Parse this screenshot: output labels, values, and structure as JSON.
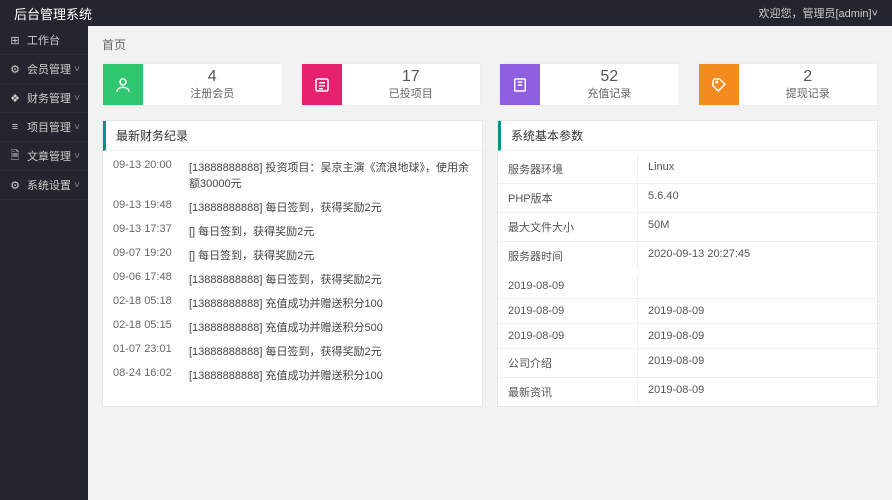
{
  "header": {
    "title": "后台管理系统",
    "user_text": "欢迎您，管理员[admin]",
    "chevron": "˅"
  },
  "sidebar": {
    "items": [
      {
        "icon": "⊞",
        "label": "工作台",
        "expandable": false
      },
      {
        "icon": "⚙",
        "label": "会员管理",
        "expandable": true
      },
      {
        "icon": "❖",
        "label": "财务管理",
        "expandable": true
      },
      {
        "icon": "≡",
        "label": "项目管理",
        "expandable": true
      },
      {
        "icon": "🗎",
        "label": "文章管理",
        "expandable": true
      },
      {
        "icon": "⚙",
        "label": "系统设置",
        "expandable": true
      }
    ]
  },
  "breadcrumb": "首页",
  "stats": [
    {
      "color": "#2ec770",
      "icon": "user",
      "num": "4",
      "label": "注册会员"
    },
    {
      "color": "#e6216f",
      "icon": "list",
      "num": "17",
      "label": "已投项目"
    },
    {
      "color": "#8e5fe0",
      "icon": "note",
      "num": "52",
      "label": "充值记录"
    },
    {
      "color": "#f58b1e",
      "icon": "tag",
      "num": "2",
      "label": "提现记录"
    }
  ],
  "finance": {
    "title": "最新财务纪录",
    "rows": [
      {
        "time": "09-13 20:00",
        "text": "[13888888888] 投资项目：吴京主演《流浪地球》，使用余额30000元"
      },
      {
        "time": "09-13 19:48",
        "text": "[13888888888] 每日签到，获得奖励2元"
      },
      {
        "time": "09-13 17:37",
        "text": "[] 每日签到，获得奖励2元"
      },
      {
        "time": "09-07 19:20",
        "text": "[] 每日签到，获得奖励2元"
      },
      {
        "time": "09-06 17:48",
        "text": "[13888888888] 每日签到，获得奖励2元"
      },
      {
        "time": "02-18 05:18",
        "text": "[13888888888] 充值成功并赠送积分100"
      },
      {
        "time": "02-18 05:15",
        "text": "[13888888888] 充值成功并赠送积分500"
      },
      {
        "time": "01-07 23:01",
        "text": "[13888888888] 每日签到，获得奖励2元"
      },
      {
        "time": "08-24 16:02",
        "text": "[13888888888] 充值成功并赠送积分100"
      }
    ]
  },
  "system": {
    "title": "系统基本参数",
    "rows": [
      {
        "k": "服务器环境",
        "v": "Linux"
      },
      {
        "k": "PHP版本",
        "v": "5.6.40"
      },
      {
        "k": "最大文件大小",
        "v": "50M"
      },
      {
        "k": "服务器时间",
        "v": "2020-09-13 20:27:45"
      }
    ]
  },
  "extra_rows": [
    {
      "a": "2019-08-09",
      "b": ""
    },
    {
      "a": "2019-08-09",
      "b": "2019-08-09"
    },
    {
      "a": "2019-08-09",
      "b": "2019-08-09"
    },
    {
      "a": "公司介绍",
      "b": "2019-08-09"
    },
    {
      "a": "最新资讯",
      "b": "2019-08-09"
    }
  ]
}
